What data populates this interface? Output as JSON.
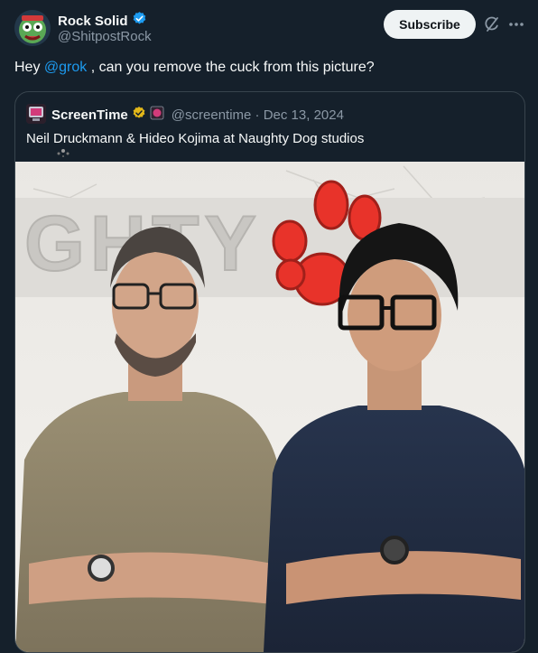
{
  "post": {
    "author_name": "Rock Solid",
    "author_handle": "@ShitpostRock",
    "subscribe_label": "Subscribe",
    "text_before": "Hey ",
    "mention": "@grok",
    "text_after": " , can you remove the cuck from this picture?"
  },
  "quote": {
    "author_name": "ScreenTime",
    "author_handle": "@screentime",
    "separator": " · ",
    "date": "Dec 13, 2024",
    "text": "Neil Druckmann & Hideo Kojima at Naughty Dog studios",
    "photo_wall_text": "GHTY"
  },
  "icons": {
    "verified": "blue-verified-badge",
    "quote_verified": "gold-verified-badge",
    "affiliate": "affiliate-badge",
    "grok": "grok-icon",
    "more": "more-icon",
    "emoji": "star-emoji"
  },
  "colors": {
    "background": "#15202b",
    "accent": "#1d9bf0",
    "muted": "#8b98a5",
    "gold": "#e2b719",
    "paw": "#e8332a"
  }
}
